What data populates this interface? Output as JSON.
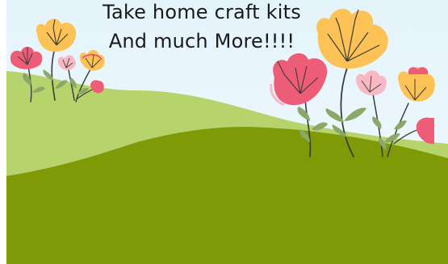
{
  "headline": {
    "line1": "Take home craft kits",
    "line2": "And much More!!!!"
  },
  "colors": {
    "sky": "#e4f4fb",
    "hill_light": "#b7d36b",
    "hill_dark": "#7f9a06",
    "petal_orange": "#fdc255",
    "petal_pink": "#ee5d78",
    "petal_light_pink": "#f8b9c4",
    "leaf": "#8aa86a",
    "stem": "#3b3b3b"
  },
  "icons": [
    "flower-icon",
    "leaf-icon"
  ]
}
